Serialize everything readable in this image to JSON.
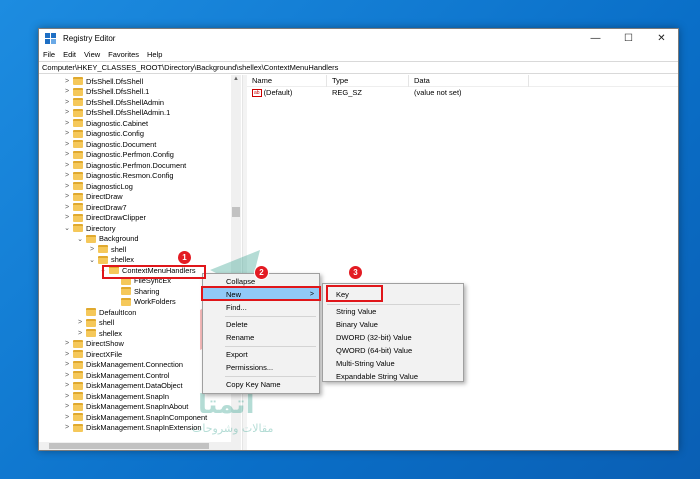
{
  "window": {
    "title": "Registry Editor",
    "controls": {
      "minimize": "—",
      "maximize": "☐",
      "close": "✕"
    }
  },
  "menubar": [
    "File",
    "Edit",
    "View",
    "Favorites",
    "Help"
  ],
  "address": "Computer\\HKEY_CLASSES_ROOT\\Directory\\Background\\shellex\\ContextMenuHandlers",
  "tree": [
    {
      "label": "DfsShell.DfsShell",
      "indent": 0,
      "exp": ">"
    },
    {
      "label": "DfsShell.DfsShell.1",
      "indent": 0,
      "exp": ">"
    },
    {
      "label": "DfsShell.DfsShellAdmin",
      "indent": 0,
      "exp": ">"
    },
    {
      "label": "DfsShell.DfsShellAdmin.1",
      "indent": 0,
      "exp": ">"
    },
    {
      "label": "Diagnostic.Cabinet",
      "indent": 0,
      "exp": ">"
    },
    {
      "label": "Diagnostic.Config",
      "indent": 0,
      "exp": ">"
    },
    {
      "label": "Diagnostic.Document",
      "indent": 0,
      "exp": ">"
    },
    {
      "label": "Diagnostic.Perfmon.Config",
      "indent": 0,
      "exp": ">"
    },
    {
      "label": "Diagnostic.Perfmon.Document",
      "indent": 0,
      "exp": ">"
    },
    {
      "label": "Diagnostic.Resmon.Config",
      "indent": 0,
      "exp": ">"
    },
    {
      "label": "DiagnosticLog",
      "indent": 0,
      "exp": ">"
    },
    {
      "label": "DirectDraw",
      "indent": 0,
      "exp": ">"
    },
    {
      "label": "DirectDraw7",
      "indent": 0,
      "exp": ">"
    },
    {
      "label": "DirectDrawClipper",
      "indent": 0,
      "exp": ">"
    },
    {
      "label": "Directory",
      "indent": 0,
      "exp": "v"
    },
    {
      "label": "Background",
      "indent": 1,
      "exp": "v"
    },
    {
      "label": "shell",
      "indent": 2,
      "exp": ">"
    },
    {
      "label": "shellex",
      "indent": 2,
      "exp": "v"
    },
    {
      "label": "ContextMenuHandlers",
      "indent": 3,
      "exp": "v"
    },
    {
      "label": "FileSyncEx",
      "indent": 4,
      "exp": ""
    },
    {
      "label": "Sharing",
      "indent": 4,
      "exp": ""
    },
    {
      "label": "WorkFolders",
      "indent": 4,
      "exp": ""
    },
    {
      "label": "DefaultIcon",
      "indent": 1,
      "exp": ""
    },
    {
      "label": "shell",
      "indent": 1,
      "exp": ">"
    },
    {
      "label": "shellex",
      "indent": 1,
      "exp": ">"
    },
    {
      "label": "DirectShow",
      "indent": 0,
      "exp": ">"
    },
    {
      "label": "DirectXFile",
      "indent": 0,
      "exp": ">"
    },
    {
      "label": "DiskManagement.Connection",
      "indent": 0,
      "exp": ">"
    },
    {
      "label": "DiskManagement.Control",
      "indent": 0,
      "exp": ">"
    },
    {
      "label": "DiskManagement.DataObject",
      "indent": 0,
      "exp": ">"
    },
    {
      "label": "DiskManagement.SnapIn",
      "indent": 0,
      "exp": ">"
    },
    {
      "label": "DiskManagement.SnapInAbout",
      "indent": 0,
      "exp": ">"
    },
    {
      "label": "DiskManagement.SnapInComponent",
      "indent": 0,
      "exp": ">"
    },
    {
      "label": "DiskManagement.SnapInExtension",
      "indent": 0,
      "exp": ">"
    }
  ],
  "values_pane": {
    "headers": [
      "Name",
      "Type",
      "Data"
    ],
    "rows": [
      {
        "name": "(Default)",
        "type": "REG_SZ",
        "data": "(value not set)",
        "icon": "ab"
      }
    ]
  },
  "context_menu": {
    "items": [
      "Collapse",
      "New",
      "Find...",
      "Delete",
      "Rename",
      "Export",
      "Permissions...",
      "Copy Key Name"
    ],
    "new_arrow": ">"
  },
  "submenu": {
    "items": [
      "Key",
      "String Value",
      "Binary Value",
      "DWORD (32-bit) Value",
      "QWORD (64-bit) Value",
      "Multi-String Value",
      "Expandable String Value"
    ]
  },
  "badges": [
    "1",
    "2",
    "3"
  ],
  "watermark": {
    "line1": "مقالات وشروحات",
    "line2": "اتمتا"
  },
  "colors": {
    "desktop": "#0a6fc8",
    "highlight": "#91c9f7",
    "annotation_red": "#e31b23",
    "folder": "#f5c85a"
  }
}
